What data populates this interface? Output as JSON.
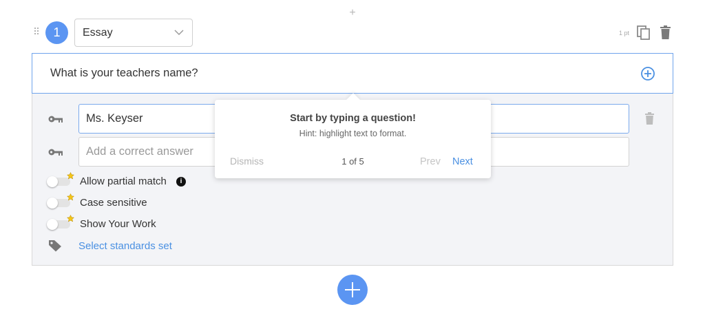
{
  "question": {
    "number": "1",
    "type": "Essay",
    "points": "1 pt",
    "text": "What is your teachers name?"
  },
  "answers": {
    "first": "Ms. Keyser",
    "placeholder": "Add a correct answer"
  },
  "options": {
    "partial_match": "Allow partial match",
    "case_sensitive": "Case sensitive",
    "show_work": "Show Your Work",
    "standards_link": "Select standards set"
  },
  "tour": {
    "title": "Start by typing a question!",
    "hint": "Hint: highlight text to format.",
    "dismiss": "Dismiss",
    "counter": "1 of 5",
    "prev": "Prev",
    "next": "Next"
  },
  "colors": {
    "accent": "#5b95f2",
    "link": "#4a90e2",
    "focus_border": "#6ea3ec"
  }
}
